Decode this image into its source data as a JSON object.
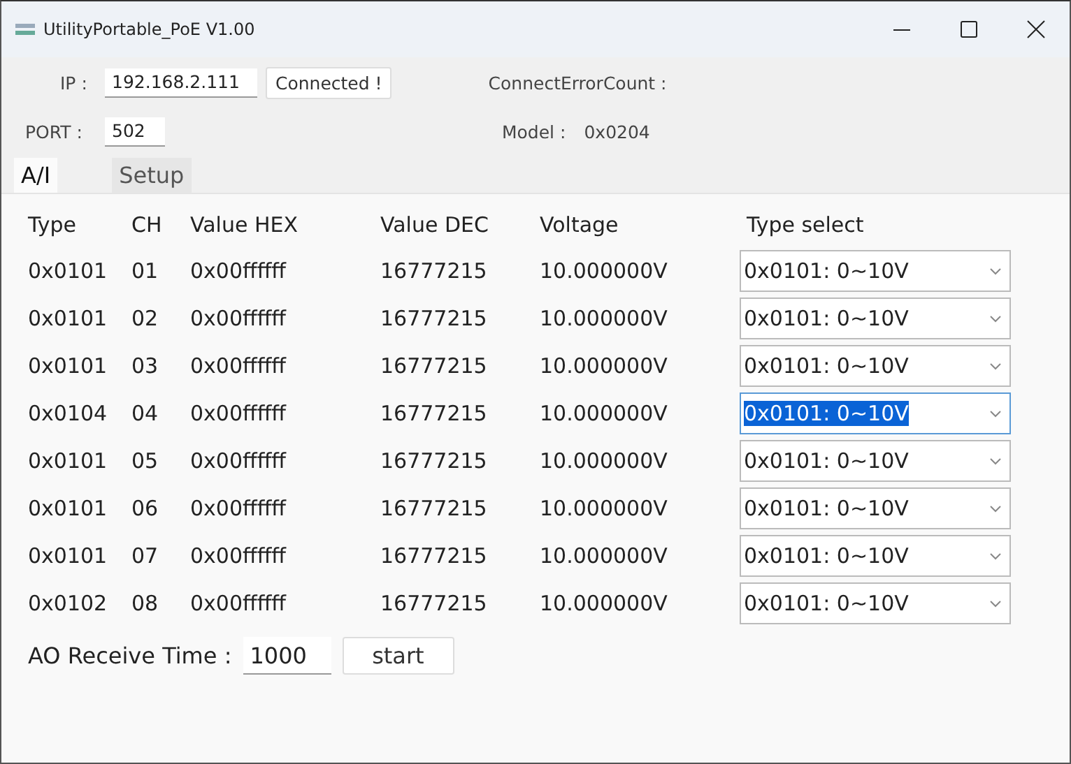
{
  "window": {
    "title": "UtilityPortable_PoE V1.00"
  },
  "connection": {
    "ip_label": "IP :",
    "ip": "192.168.2.111",
    "connect_button": "Connected !",
    "error_label": "ConnectErrorCount :",
    "port_label": "PORT :",
    "port": "502",
    "model_label": "Model :",
    "model": "0x0204"
  },
  "tabs": [
    {
      "label": "A/I",
      "selected": true
    },
    {
      "label": "Setup",
      "selected": false
    }
  ],
  "table": {
    "columns": [
      "Type",
      "CH",
      "Value HEX",
      "Value DEC",
      "Voltage",
      "Type select"
    ],
    "rows": [
      {
        "type": "0x0101",
        "ch": "01",
        "hex": "0x00ffffff",
        "dec": "16777215",
        "voltage": "10.000000V",
        "select": "0x0101: 0~10V",
        "focused": false
      },
      {
        "type": "0x0101",
        "ch": "02",
        "hex": "0x00ffffff",
        "dec": "16777215",
        "voltage": "10.000000V",
        "select": "0x0101: 0~10V",
        "focused": false
      },
      {
        "type": "0x0101",
        "ch": "03",
        "hex": "0x00ffffff",
        "dec": "16777215",
        "voltage": "10.000000V",
        "select": "0x0101: 0~10V",
        "focused": false
      },
      {
        "type": "0x0104",
        "ch": "04",
        "hex": "0x00ffffff",
        "dec": "16777215",
        "voltage": "10.000000V",
        "select": "0x0101: 0~10V",
        "focused": true
      },
      {
        "type": "0x0101",
        "ch": "05",
        "hex": "0x00ffffff",
        "dec": "16777215",
        "voltage": "10.000000V",
        "select": "0x0101: 0~10V",
        "focused": false
      },
      {
        "type": "0x0101",
        "ch": "06",
        "hex": "0x00ffffff",
        "dec": "16777215",
        "voltage": "10.000000V",
        "select": "0x0101: 0~10V",
        "focused": false
      },
      {
        "type": "0x0101",
        "ch": "07",
        "hex": "0x00ffffff",
        "dec": "16777215",
        "voltage": "10.000000V",
        "select": "0x0101: 0~10V",
        "focused": false
      },
      {
        "type": "0x0102",
        "ch": "08",
        "hex": "0x00ffffff",
        "dec": "16777215",
        "voltage": "10.000000V",
        "select": "0x0101: 0~10V",
        "focused": false
      }
    ]
  },
  "ao": {
    "label": "AO Receive Time :",
    "value": "1000",
    "button": "start"
  }
}
